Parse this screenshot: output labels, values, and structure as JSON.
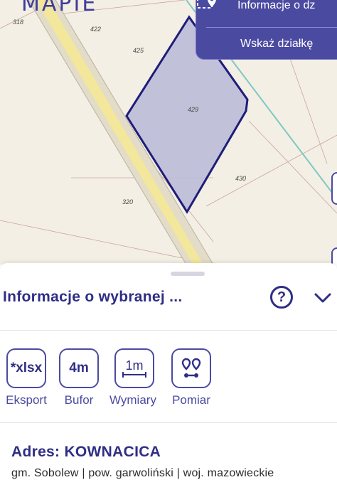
{
  "map": {
    "brand": "MAPIE",
    "parcel_numbers": {
      "p318": "318",
      "p422": "422",
      "p425": "425",
      "p429": "429",
      "p430": "430",
      "p320": "320"
    },
    "info_button_label": "Informacje o dz",
    "point_parcel_label": "Wskaż działkę",
    "selection_color": "#1e1d7a",
    "selection_fill": "#b9b8d8"
  },
  "sheet": {
    "title": "Informacje o wybranej ...",
    "help_symbol": "?",
    "tools": [
      {
        "icon_text": "*xlsx",
        "label": "Eksport"
      },
      {
        "icon_text": "4m",
        "label": "Bufor"
      },
      {
        "icon_text": "1m",
        "label": "Wymiary"
      },
      {
        "icon_text": "",
        "label": "Pomiar"
      }
    ],
    "address": "Adres: KOWNACICA",
    "admin": "gm. Sobolew | pow. garwoliński | woj. mazowieckie"
  },
  "colors": {
    "accent": "#4b4aa1",
    "dark": "#2f2e86"
  }
}
